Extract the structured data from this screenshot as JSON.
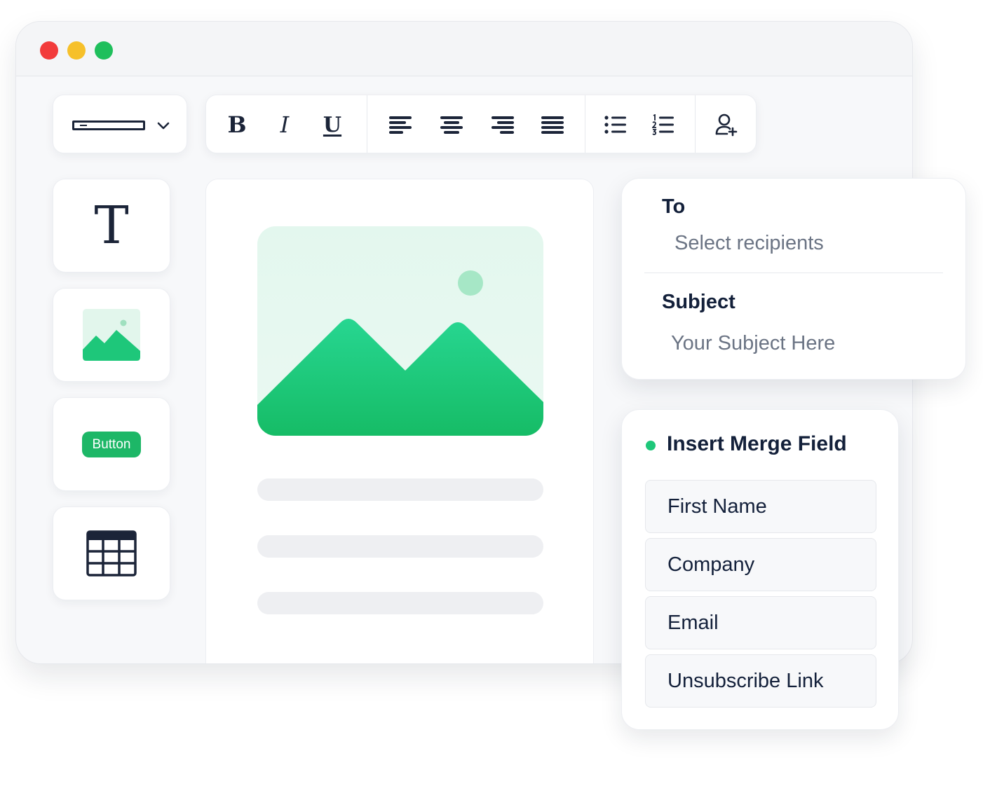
{
  "window": {
    "controls": {
      "close_color": "#f23b3b",
      "minimize_color": "#f6c02a",
      "maximize_color": "#1fbf5c"
    }
  },
  "toolbar": {
    "font_select_icon": "chevron-down-icon",
    "format": {
      "bold": "B",
      "italic": "I",
      "underline": "U"
    },
    "align_icons": [
      "align-left-icon",
      "align-center-icon",
      "align-right-icon",
      "align-justify-icon"
    ],
    "list_icons": [
      "bullet-list-icon",
      "numbered-list-icon"
    ],
    "personalize_icon": "add-person-icon"
  },
  "blocks": {
    "text_glyph": "T",
    "image_icon": "image-icon",
    "button_label": "Button",
    "table_icon": "table-icon"
  },
  "canvas": {
    "hero_icon": "image-placeholder",
    "text_lines": 3
  },
  "recipients": {
    "to_label": "To",
    "to_placeholder": "Select recipients",
    "subject_label": "Subject",
    "subject_placeholder": "Your Subject Here"
  },
  "merge": {
    "title": "Insert Merge Field",
    "fields": [
      "First Name",
      "Company",
      "Email",
      "Unsubscribe Link"
    ]
  },
  "colors": {
    "accent": "#1db767",
    "text_dark": "#13203a",
    "placeholder": "#6b7484"
  }
}
